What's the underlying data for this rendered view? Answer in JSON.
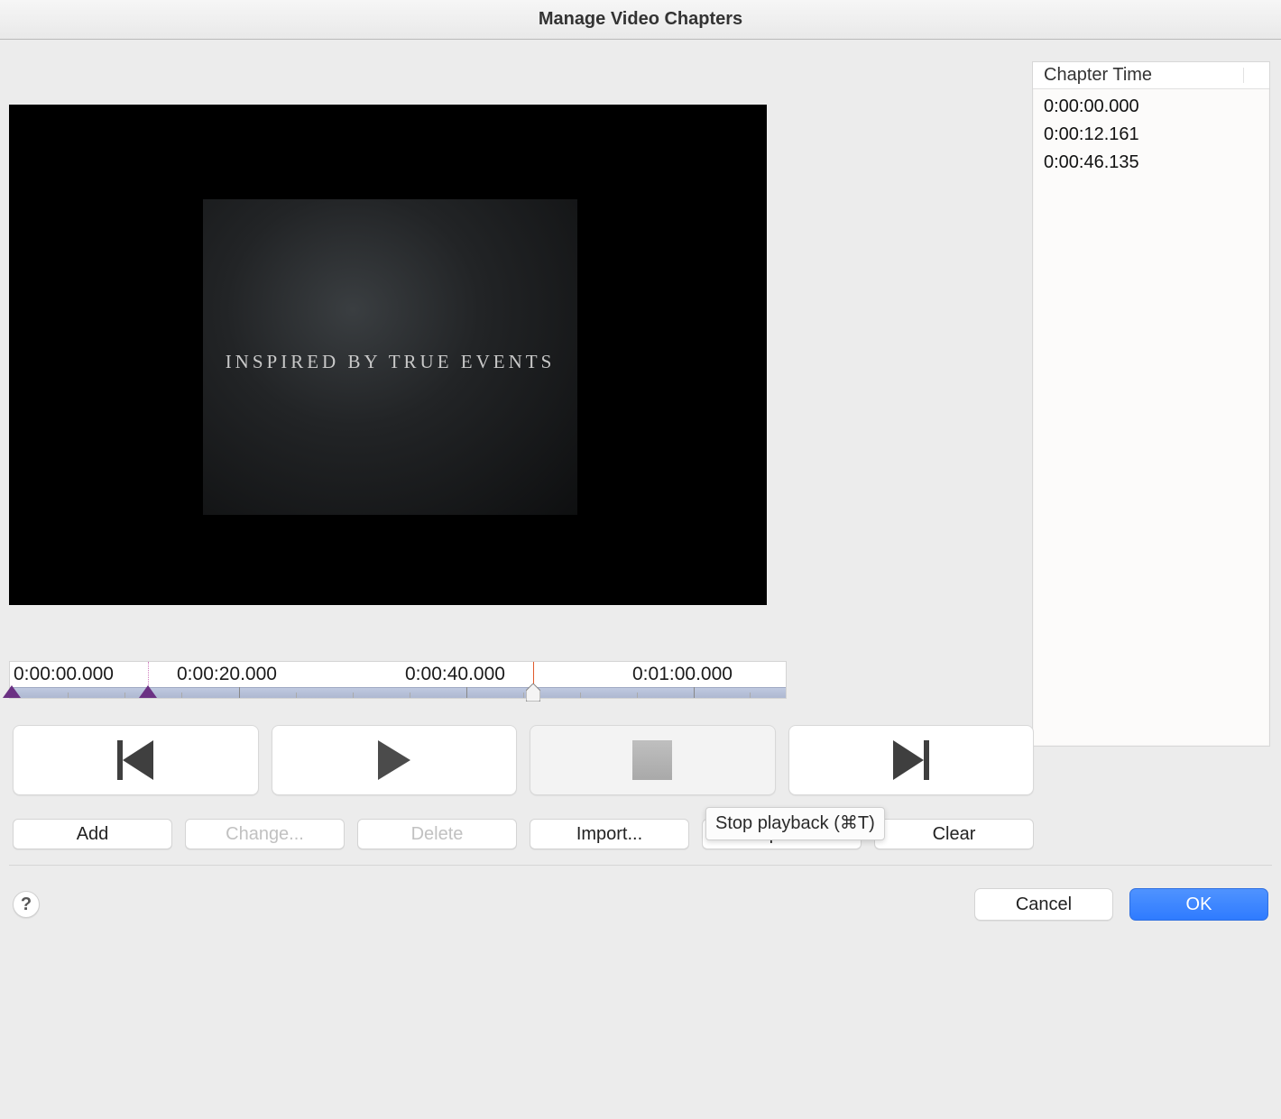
{
  "window": {
    "title": "Manage Video Chapters"
  },
  "video": {
    "overlay_text": "INSPIRED BY TRUE EVENTS"
  },
  "chapter_table": {
    "header": "Chapter Time",
    "rows": [
      "0:00:00.000",
      "0:00:12.161",
      "0:00:46.135"
    ]
  },
  "timeline": {
    "labels": [
      "0:00:00.000",
      "0:00:20.000",
      "0:00:40.000",
      "0:01:00.000"
    ],
    "label_positions_pct": [
      0,
      29.3,
      58.6,
      87.9
    ],
    "chapter_marker_positions_pct": [
      0,
      17.8,
      67.6
    ],
    "playhead_pct": 67.6,
    "dotline_pct": 17.8
  },
  "transport": {
    "prev_tooltip": "Previous chapter",
    "play_tooltip": "Play",
    "stop_tooltip": "Stop playback (⌘T)",
    "next_tooltip": "Next chapter"
  },
  "actions": {
    "add": "Add",
    "change": "Change...",
    "delete": "Delete",
    "import": "Import...",
    "export": "Export...",
    "clear": "Clear"
  },
  "tooltip_text": "Stop playback (⌘T)",
  "footer": {
    "help": "?",
    "cancel": "Cancel",
    "ok": "OK"
  }
}
